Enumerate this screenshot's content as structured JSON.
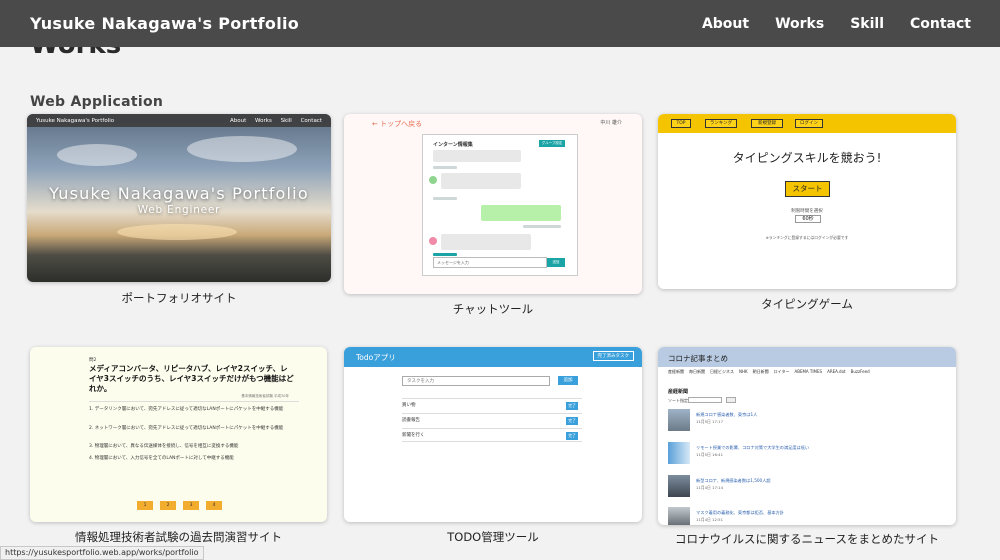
{
  "header": {
    "site_title": "Yusuke Nakagawa's Portfolio",
    "nav": [
      "About",
      "Works",
      "Skill",
      "Contact"
    ]
  },
  "page": {
    "heading": "Works",
    "section_heading": "Web Application"
  },
  "cards": [
    {
      "label": "ポートフォリオサイト"
    },
    {
      "label": "チャットツール"
    },
    {
      "label": "タイピングゲーム"
    },
    {
      "label": "情報処理技術者試験の過去問演習サイト"
    },
    {
      "label": "TODO管理ツール"
    },
    {
      "label": "コロナウイルスに関するニュースをまとめたサイト"
    }
  ],
  "thumbs": {
    "portfolio": {
      "bar_title": "Yusuke Nakagawa's Portfolio",
      "bar_nav": [
        "About",
        "Works",
        "Skill",
        "Contact"
      ],
      "hero_title": "Yusuke Nakagawa's Portfolio",
      "hero_sub": "Web Engineer"
    },
    "chat": {
      "back": "← トップへ戻る",
      "user": "中川 雄介",
      "panel_title": "インターン情報集",
      "panel_button": "グループ設定",
      "input_placeholder": "メッセージを入力",
      "send": "送信"
    },
    "typing": {
      "buttons": [
        "TOP",
        "ランキング",
        "新規登録",
        "ログイン"
      ],
      "title": "タイピングスキルを競おう!",
      "start": "スタート",
      "time_label": "制限時間を選択",
      "time_value": "60秒",
      "note": "※ランキングに登録するにはログインが必要です"
    },
    "exam": {
      "qno": "問2",
      "question": "メディアコンバータ、リピータハブ、レイヤ2スイッチ、レイヤ3スイッチのうち、レイヤ3スイッチだけがもつ機能はどれか。",
      "source": "基本情報技術者試験 平成30年",
      "options": [
        "1. データリンク層において、宛先アドレスに従って適切なLANポートにパケットを中継する機能",
        "2. ネットワーク層において、宛先アドレスに従って適切なLANポートにパケットを中継する機能",
        "3. 物理層において、異なる伝送媒体を接続し、信号を相互に変換する機能",
        "4. 物理層において、入力信号を全てのLANポートに対して中継する機能"
      ],
      "pages": [
        "1",
        "2",
        "3",
        "4"
      ]
    },
    "todo": {
      "title": "Todoアプリ",
      "done_button": "完了済みタスク",
      "input_placeholder": "タスクを入力",
      "add": "追加",
      "tasks": [
        "買い物",
        "読書報告",
        "新聞を行く"
      ],
      "finish": "完了"
    },
    "news": {
      "title": "コロナ記事まとめ",
      "subnav": [
        "産経新聞",
        "毎日新聞",
        "日経ビジネス",
        "NHK",
        "朝日新聞",
        "ロイター",
        "ABEMA TIMES",
        "AREA.dot",
        "BuzzFeed"
      ],
      "section": "産経新聞",
      "sort_label": "ソート指定",
      "items": [
        {
          "title": "新規コロナ感染者数、東京は1人",
          "date": "11月5日 17:17"
        },
        {
          "title": "リモート授業での影響、コロナ対策で大学生の満足度は低い",
          "date": "11月5日 16:41"
        },
        {
          "title": "新型コロナ、新規感染者数は1,500人超",
          "date": "11月4日 17:14"
        },
        {
          "title": "マスク着用の義務化、東京都は拒否、基本方針",
          "date": "11月4日 12:51"
        }
      ]
    }
  },
  "status_bar": {
    "url": "https://yusukesportfolio.web.app/works/portfolio"
  }
}
